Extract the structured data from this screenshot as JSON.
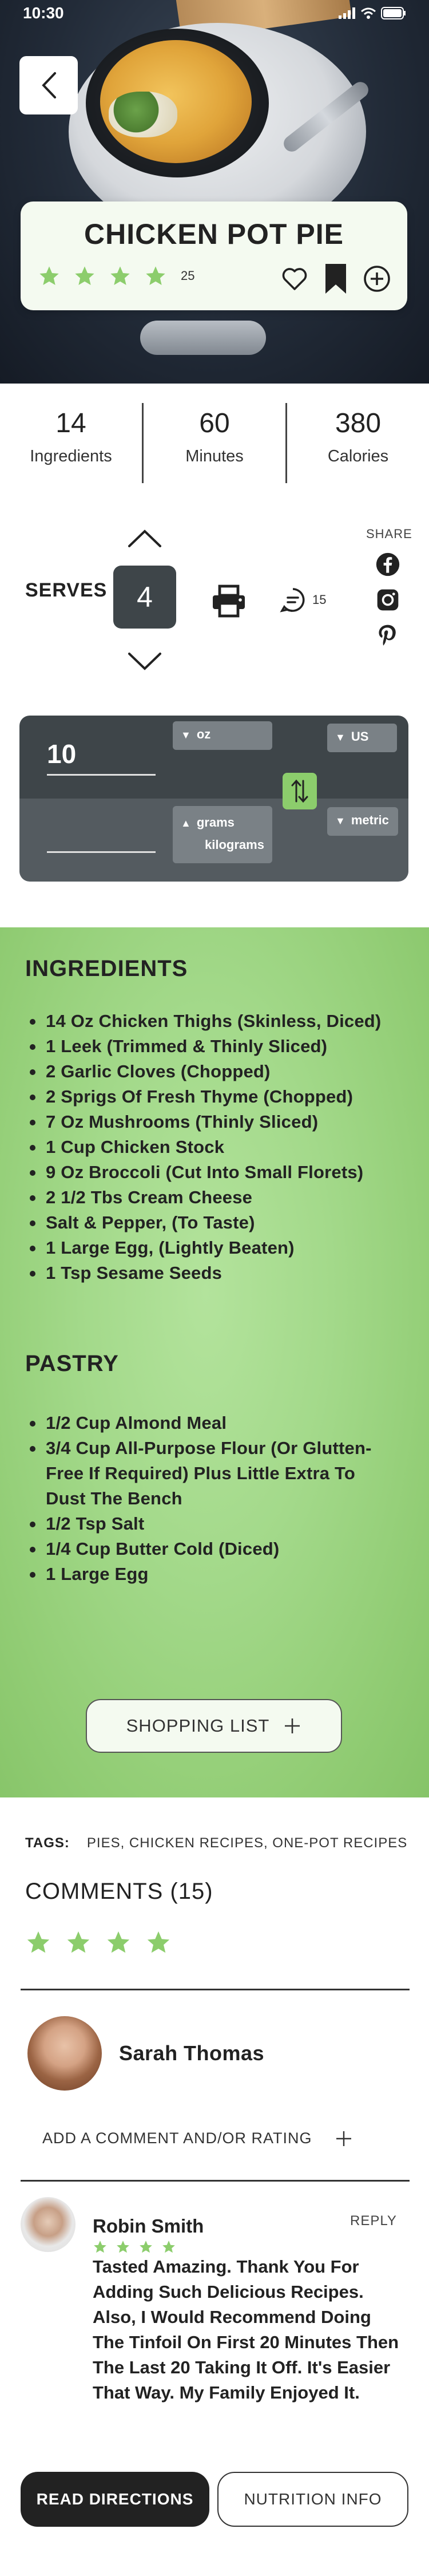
{
  "status_bar": {
    "time": "10:30"
  },
  "recipe": {
    "title": "CHICKEN POT PIE",
    "rating_count": "25",
    "stars": 4
  },
  "stats": [
    {
      "value": "14",
      "label": "Ingredients"
    },
    {
      "value": "60",
      "label": "Minutes"
    },
    {
      "value": "380",
      "label": "Calories"
    }
  ],
  "serves": {
    "label": "SERVES",
    "value": "4"
  },
  "comment_count": "15",
  "share": {
    "label": "SHARE",
    "icons": [
      "facebook-icon",
      "instagram-icon",
      "pinterest-icon"
    ]
  },
  "converter": {
    "input_value": "10",
    "from_unit": "oz",
    "from_system": "US",
    "to_units": [
      "grams",
      "kilograms"
    ],
    "to_system": "metric"
  },
  "ingredients": {
    "title": "INGREDIENTS",
    "items": [
      "14  Oz Chicken Thighs (Skinless, Diced)",
      "1 Leek (Trimmed & Thinly Sliced)",
      "2 Garlic Cloves (Chopped)",
      "2 Sprigs Of Fresh Thyme (Chopped)",
      "7 Oz Mushrooms (Thinly Sliced)",
      "1 Cup Chicken Stock",
      "9 Oz Broccoli (Cut Into Small Florets)",
      "2 1/2 Tbs Cream Cheese",
      "Salt & Pepper, (To Taste)",
      "1 Large Egg, (Lightly Beaten)",
      "1 Tsp Sesame Seeds"
    ]
  },
  "pastry": {
    "title": "PASTRY",
    "items": [
      "1/2 Cup Almond Meal",
      "3/4 Cup All-Purpose Flour (Or Glutten-Free If Required) Plus Little Extra To Dust The Bench",
      "1/2 Tsp Salt",
      "1/4 Cup Butter Cold (Diced)",
      "1 Large Egg"
    ]
  },
  "shopping_list": {
    "label": "SHOPPING LIST"
  },
  "tags": {
    "label": "TAGS:",
    "values": "PIES, CHICKEN RECIPES, ONE-POT RECIPES"
  },
  "comments": {
    "title": "COMMENTS (15)",
    "current_user": "Sarah Thomas",
    "add_label": "ADD A COMMENT AND/OR RATING",
    "review": {
      "name": "Robin Smith",
      "reply_label": "REPLY",
      "stars": 4,
      "text": "Tasted Amazing. Thank You For Adding Such Delicious Recipes. Also, I Would Recommend Doing The Tinfoil On First 20 Minutes Then The Last 20 Taking It Off. It's Easier That Way. My Family Enjoyed It."
    }
  },
  "bottom": {
    "directions": "READ DIRECTIONS",
    "nutrition": "NUTRITION INFO"
  },
  "colors": {
    "accent_green": "#8ccd6c",
    "dark": "#3e4549",
    "panel_bg": "#f4faf0"
  }
}
